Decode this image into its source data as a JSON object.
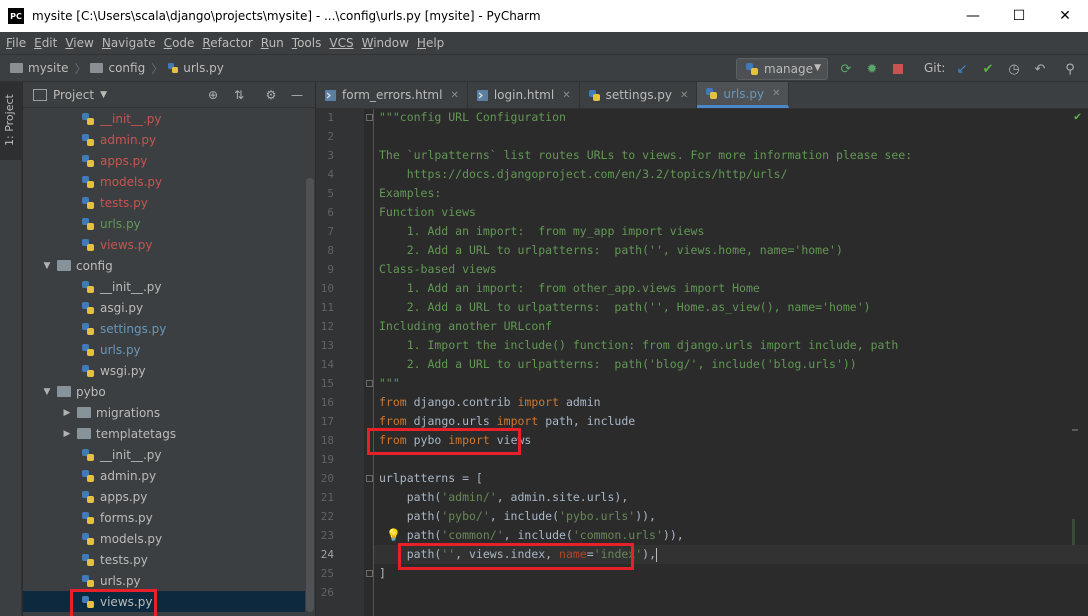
{
  "window": {
    "logo": "PC",
    "title": "mysite [C:\\Users\\scala\\django\\projects\\mysite] - ...\\config\\urls.py [mysite] - PyCharm",
    "minimize": "—",
    "maximize": "☐",
    "close": "✕"
  },
  "menu": [
    {
      "u": "F",
      "rest": "ile"
    },
    {
      "u": "E",
      "rest": "dit"
    },
    {
      "u": "V",
      "rest": "iew"
    },
    {
      "u": "N",
      "rest": "avigate"
    },
    {
      "u": "C",
      "rest": "ode"
    },
    {
      "u": "R",
      "rest": "efactor"
    },
    {
      "u": "R",
      "rest": "un"
    },
    {
      "u": "T",
      "rest": "ools"
    },
    {
      "u": "VCS",
      "rest": ""
    },
    {
      "u": "W",
      "rest": "indow"
    },
    {
      "u": "H",
      "rest": "elp"
    }
  ],
  "breadcrumb": [
    "mysite",
    "config",
    "urls.py"
  ],
  "toolbar": {
    "run_config": "manage",
    "git_label": "Git:"
  },
  "stripe_label": "1: Project",
  "project_panel": {
    "title": "Project"
  },
  "tree": [
    {
      "name": "__init__.py",
      "indent": 3,
      "color": "#c75450",
      "type": "py"
    },
    {
      "name": "admin.py",
      "indent": 3,
      "color": "#c75450",
      "type": "py"
    },
    {
      "name": "apps.py",
      "indent": 3,
      "color": "#c75450",
      "type": "py"
    },
    {
      "name": "models.py",
      "indent": 3,
      "color": "#c75450",
      "type": "py"
    },
    {
      "name": "tests.py",
      "indent": 3,
      "color": "#c75450",
      "type": "py"
    },
    {
      "name": "urls.py",
      "indent": 3,
      "color": "#629755",
      "type": "py"
    },
    {
      "name": "views.py",
      "indent": 3,
      "color": "#c75450",
      "type": "py"
    },
    {
      "name": "config",
      "indent": 1,
      "color": "#bbbbbb",
      "type": "dir",
      "open": true
    },
    {
      "name": "__init__.py",
      "indent": 3,
      "color": "#bbbbbb",
      "type": "py"
    },
    {
      "name": "asgi.py",
      "indent": 3,
      "color": "#bbbbbb",
      "type": "py"
    },
    {
      "name": "settings.py",
      "indent": 3,
      "color": "#6897bb",
      "type": "py"
    },
    {
      "name": "urls.py",
      "indent": 3,
      "color": "#6897bb",
      "type": "py"
    },
    {
      "name": "wsgi.py",
      "indent": 3,
      "color": "#bbbbbb",
      "type": "py"
    },
    {
      "name": "pybo",
      "indent": 1,
      "color": "#bbbbbb",
      "type": "dir",
      "open": true
    },
    {
      "name": "migrations",
      "indent": 2,
      "color": "#bbbbbb",
      "type": "dir",
      "open": false
    },
    {
      "name": "templatetags",
      "indent": 2,
      "color": "#bbbbbb",
      "type": "dir",
      "open": false
    },
    {
      "name": "__init__.py",
      "indent": 3,
      "color": "#bbbbbb",
      "type": "py"
    },
    {
      "name": "admin.py",
      "indent": 3,
      "color": "#bbbbbb",
      "type": "py"
    },
    {
      "name": "apps.py",
      "indent": 3,
      "color": "#bbbbbb",
      "type": "py"
    },
    {
      "name": "forms.py",
      "indent": 3,
      "color": "#bbbbbb",
      "type": "py"
    },
    {
      "name": "models.py",
      "indent": 3,
      "color": "#bbbbbb",
      "type": "py"
    },
    {
      "name": "tests.py",
      "indent": 3,
      "color": "#bbbbbb",
      "type": "py"
    },
    {
      "name": "urls.py",
      "indent": 3,
      "color": "#bbbbbb",
      "type": "py"
    },
    {
      "name": "views.py",
      "indent": 3,
      "color": "#bbbbbb",
      "type": "py",
      "selected": true
    }
  ],
  "tabs": [
    {
      "name": "form_errors.html",
      "type": "html"
    },
    {
      "name": "login.html",
      "type": "html"
    },
    {
      "name": "settings.py",
      "type": "py"
    },
    {
      "name": "urls.py",
      "type": "py",
      "active": true
    }
  ],
  "code": {
    "current_line": 24,
    "lines": [
      [
        [
          "doc",
          "\"\"\"config URL Configuration"
        ]
      ],
      [],
      [
        [
          "doc",
          "The `urlpatterns` list routes URLs to views. For more information please see:"
        ]
      ],
      [
        [
          "doc",
          "    https://docs.djangoproject.com/en/3.2/topics/http/urls/"
        ]
      ],
      [
        [
          "doc",
          "Examples:"
        ]
      ],
      [
        [
          "doc",
          "Function views"
        ]
      ],
      [
        [
          "doc",
          "    1. Add an import:  from my_app import views"
        ]
      ],
      [
        [
          "doc",
          "    2. Add a URL to urlpatterns:  path('', views.home, name='home')"
        ]
      ],
      [
        [
          "doc",
          "Class-based views"
        ]
      ],
      [
        [
          "doc",
          "    1. Add an import:  from other_app.views import Home"
        ]
      ],
      [
        [
          "doc",
          "    2. Add a URL to urlpatterns:  path('', Home.as_view(), name='home')"
        ]
      ],
      [
        [
          "doc",
          "Including another URLconf"
        ]
      ],
      [
        [
          "doc",
          "    1. Import the include() function: from django.urls import include, path"
        ]
      ],
      [
        [
          "doc",
          "    2. Add a URL to urlpatterns:  path('blog/', include('blog.urls'))"
        ]
      ],
      [
        [
          "doc",
          "\"\"\""
        ]
      ],
      [
        [
          "kw",
          "from"
        ],
        [
          "t",
          " django.contrib "
        ],
        [
          "kw",
          "import"
        ],
        [
          "t",
          " admin"
        ]
      ],
      [
        [
          "kw",
          "from"
        ],
        [
          "t",
          " django.urls "
        ],
        [
          "kw",
          "import"
        ],
        [
          "t",
          " path, include"
        ]
      ],
      [
        [
          "kw",
          "from"
        ],
        [
          "t",
          " pybo "
        ],
        [
          "kw",
          "import"
        ],
        [
          "t",
          " views"
        ]
      ],
      [],
      [
        [
          "t",
          "urlpatterns = ["
        ]
      ],
      [
        [
          "t",
          "    path("
        ],
        [
          "str",
          "'admin/'"
        ],
        [
          "t",
          ", admin.site.urls),"
        ]
      ],
      [
        [
          "t",
          "    path("
        ],
        [
          "str",
          "'pybo/'"
        ],
        [
          "t",
          ", include("
        ],
        [
          "str",
          "'pybo.urls'"
        ],
        [
          "t",
          ")),"
        ]
      ],
      [
        [
          "t",
          "    path("
        ],
        [
          "str",
          "'common/'"
        ],
        [
          "t",
          ", include("
        ],
        [
          "str",
          "'common.urls'"
        ],
        [
          "t",
          ")),"
        ]
      ],
      [
        [
          "t",
          "    path("
        ],
        [
          "str",
          "''"
        ],
        [
          "t",
          ", views.index, "
        ],
        [
          "nm",
          "name"
        ],
        [
          "t",
          "="
        ],
        [
          "str",
          "'index'"
        ],
        [
          "t",
          "),"
        ]
      ],
      [
        [
          "t",
          "]"
        ]
      ],
      []
    ]
  }
}
